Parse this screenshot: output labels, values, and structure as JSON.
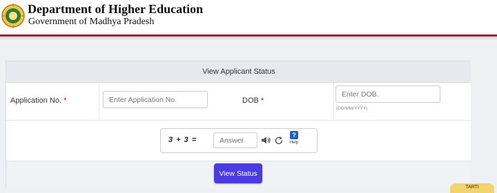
{
  "header": {
    "title": "Department of Higher Education",
    "subtitle": "Government of Madhya Pradesh"
  },
  "panel": {
    "heading": "View Applicant Status"
  },
  "form": {
    "application_label": "Application No.",
    "application_required": "*",
    "application_placeholder": "Enter Application No.",
    "dob_label": "DOB",
    "dob_required": "*",
    "dob_placeholder": "Enter DOB.",
    "dob_hint": "(DD/MM/YYYY)"
  },
  "captcha": {
    "expression": "3 + 3 =",
    "answer_placeholder": "Answer",
    "help_label": "Help",
    "help_glyph": "?"
  },
  "actions": {
    "view_status_label": "View Status"
  },
  "corner_tab": {
    "label": "TARTI"
  },
  "colors": {
    "header_border": "#a01c2c",
    "button": "#4a3ce0",
    "required": "#d0021b",
    "help_icon": "#1f5fbf",
    "tab": "#f3d36b"
  }
}
